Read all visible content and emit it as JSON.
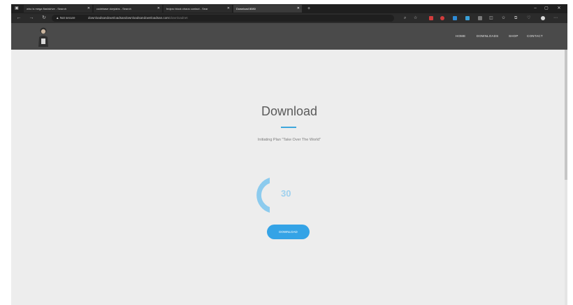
{
  "browser": {
    "tabs": [
      {
        "title": "who is mega flashdrive - Search",
        "active": false
      },
      {
        "title": "codebase dorylabs - Search",
        "active": false
      },
      {
        "title": "fedpro block chaos contact - Sear",
        "active": false
      },
      {
        "title": "Download 8080",
        "active": true
      }
    ],
    "new_tab": "+",
    "window_controls": {
      "minimize": "–",
      "maximize": "▢",
      "close": "✕"
    },
    "nav": {
      "back": "←",
      "forward": "→",
      "reload": "↻"
    },
    "address": {
      "security_label": "Not secure",
      "host": "downloadsandownloadsandownloadsandownloadsan.com",
      "path": "/downloadnet"
    },
    "toolbar_icons": [
      "zoom-icon",
      "star-icon",
      "extension-red-icon",
      "extension-blue-icon",
      "extensions-icon",
      "split-screen-icon",
      "favorites-icon",
      "collections-icon",
      "profile-icon",
      "more-icon"
    ]
  },
  "site": {
    "nav": [
      "HOME",
      "DOWNLOADS",
      "SHOP",
      "CONTACT"
    ]
  },
  "main": {
    "title": "Download",
    "subtitle": "Initiating Plan \"Take Over The World\"",
    "countdown": "30",
    "download_button": "DOWNLOAD"
  },
  "colors": {
    "accent": "#3fa7dc",
    "button": "#34a3e6",
    "gauge": "#8ccbee",
    "header": "#4a4a4a",
    "page_bg": "#ededed"
  }
}
